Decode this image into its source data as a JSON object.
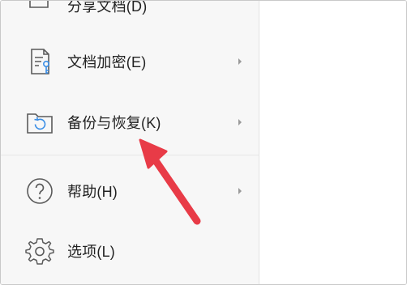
{
  "menu": {
    "items": [
      {
        "label": "分享文档(D)",
        "icon": "share-document-icon",
        "has_submenu": false
      },
      {
        "label": "文档加密(E)",
        "icon": "document-encrypt-icon",
        "has_submenu": true
      },
      {
        "label": "备份与恢复(K)",
        "icon": "backup-restore-folder-icon",
        "has_submenu": true
      },
      {
        "label": "帮助(H)",
        "icon": "help-icon",
        "has_submenu": true
      },
      {
        "label": "选项(L)",
        "icon": "gear-icon",
        "has_submenu": false
      }
    ]
  },
  "annotation": {
    "arrow_color": "#e83b47",
    "points_to": "备份与恢复(K)"
  }
}
